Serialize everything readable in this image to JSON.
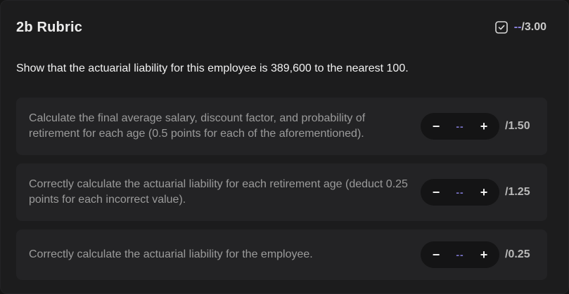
{
  "rubric": {
    "title": "2b Rubric",
    "total_score": "--",
    "total_max": "/3.00",
    "question": "Show that the actuarial liability for this employee is 389,600 to the nearest 100."
  },
  "criteria": [
    {
      "text": "Calculate the final average salary, discount factor, and probability of retirement for each age (0.5 points for each of the aforementioned).",
      "minus": "−",
      "value": "--",
      "plus": "+",
      "max": "/1.50"
    },
    {
      "text": "Correctly calculate the actuarial liability for each retirement age (deduct 0.25 points for each incorrect value).",
      "minus": "−",
      "value": "--",
      "plus": "+",
      "max": "/1.25"
    },
    {
      "text": "Correctly calculate the actuarial liability for the employee.",
      "minus": "−",
      "value": "--",
      "plus": "+",
      "max": "/0.25"
    }
  ],
  "icons": {
    "total": "checkbox-check-icon"
  },
  "colors": {
    "accent": "#8e86e6",
    "background": "#1c1c1d",
    "card": "#232325"
  }
}
